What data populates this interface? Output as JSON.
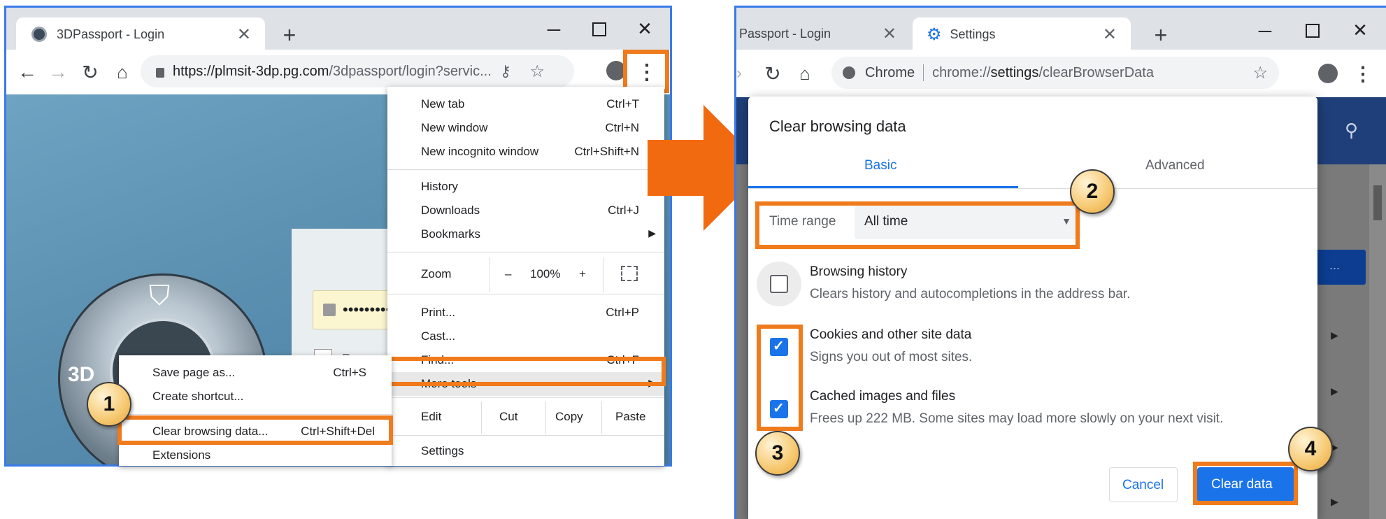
{
  "left_window": {
    "tab_title": "3DPassport - Login",
    "url_host": "https://plmsit-3dp.pg.com",
    "url_path": "/3dpassport/login?servic...",
    "login_placeholder": "•••••••••",
    "remember_label": "Remem",
    "compass_label": "3D"
  },
  "chrome_menu": {
    "items_top": [
      {
        "label": "New tab",
        "shortcut": "Ctrl+T"
      },
      {
        "label": "New window",
        "shortcut": "Ctrl+N"
      },
      {
        "label": "New incognito window",
        "shortcut": "Ctrl+Shift+N"
      }
    ],
    "history": "History",
    "downloads": {
      "label": "Downloads",
      "shortcut": "Ctrl+J"
    },
    "bookmarks": "Bookmarks",
    "zoom": {
      "label": "Zoom",
      "minus": "–",
      "value": "100%",
      "plus": "+"
    },
    "print": {
      "label": "Print...",
      "shortcut": "Ctrl+P"
    },
    "cast": "Cast...",
    "find": {
      "label": "Find...",
      "shortcut": "Ctrl+F"
    },
    "more_tools": "More tools",
    "edit": {
      "label": "Edit",
      "cut": "Cut",
      "copy": "Copy",
      "paste": "Paste"
    },
    "settings": "Settings"
  },
  "submenu": {
    "save_page": {
      "label": "Save page as...",
      "shortcut": "Ctrl+S"
    },
    "create_shortcut": "Create shortcut...",
    "clear_browsing": {
      "label": "Clear browsing data...",
      "shortcut": "Ctrl+Shift+Del"
    },
    "extensions": "Extensions"
  },
  "right_window": {
    "tab1_title": "Passport - Login",
    "tab2_title": "Settings",
    "omnibox_label": "Chrome",
    "url_scheme": "chrome://",
    "url_bold": "settings",
    "url_rest": "/clearBrowserData",
    "bg_button_text": "..."
  },
  "dialog": {
    "title": "Clear browsing data",
    "tab_basic": "Basic",
    "tab_advanced": "Advanced",
    "time_range_label": "Time range",
    "time_range_value": "All time",
    "options": [
      {
        "title": "Browsing history",
        "desc": "Clears history and autocompletions in the address bar.",
        "checked": false
      },
      {
        "title": "Cookies and other site data",
        "desc": "Signs you out of most sites.",
        "checked": true
      },
      {
        "title": "Cached images and files",
        "desc": "Frees up 222 MB. Some sites may load more slowly on your next visit.",
        "checked": true
      }
    ],
    "cancel_label": "Cancel",
    "clear_label": "Clear data"
  },
  "steps": [
    "1",
    "2",
    "3",
    "4"
  ],
  "colors": {
    "highlight": "#f07b1c",
    "window_border": "#3a7ae8",
    "accent_blue": "#1a73e8"
  }
}
